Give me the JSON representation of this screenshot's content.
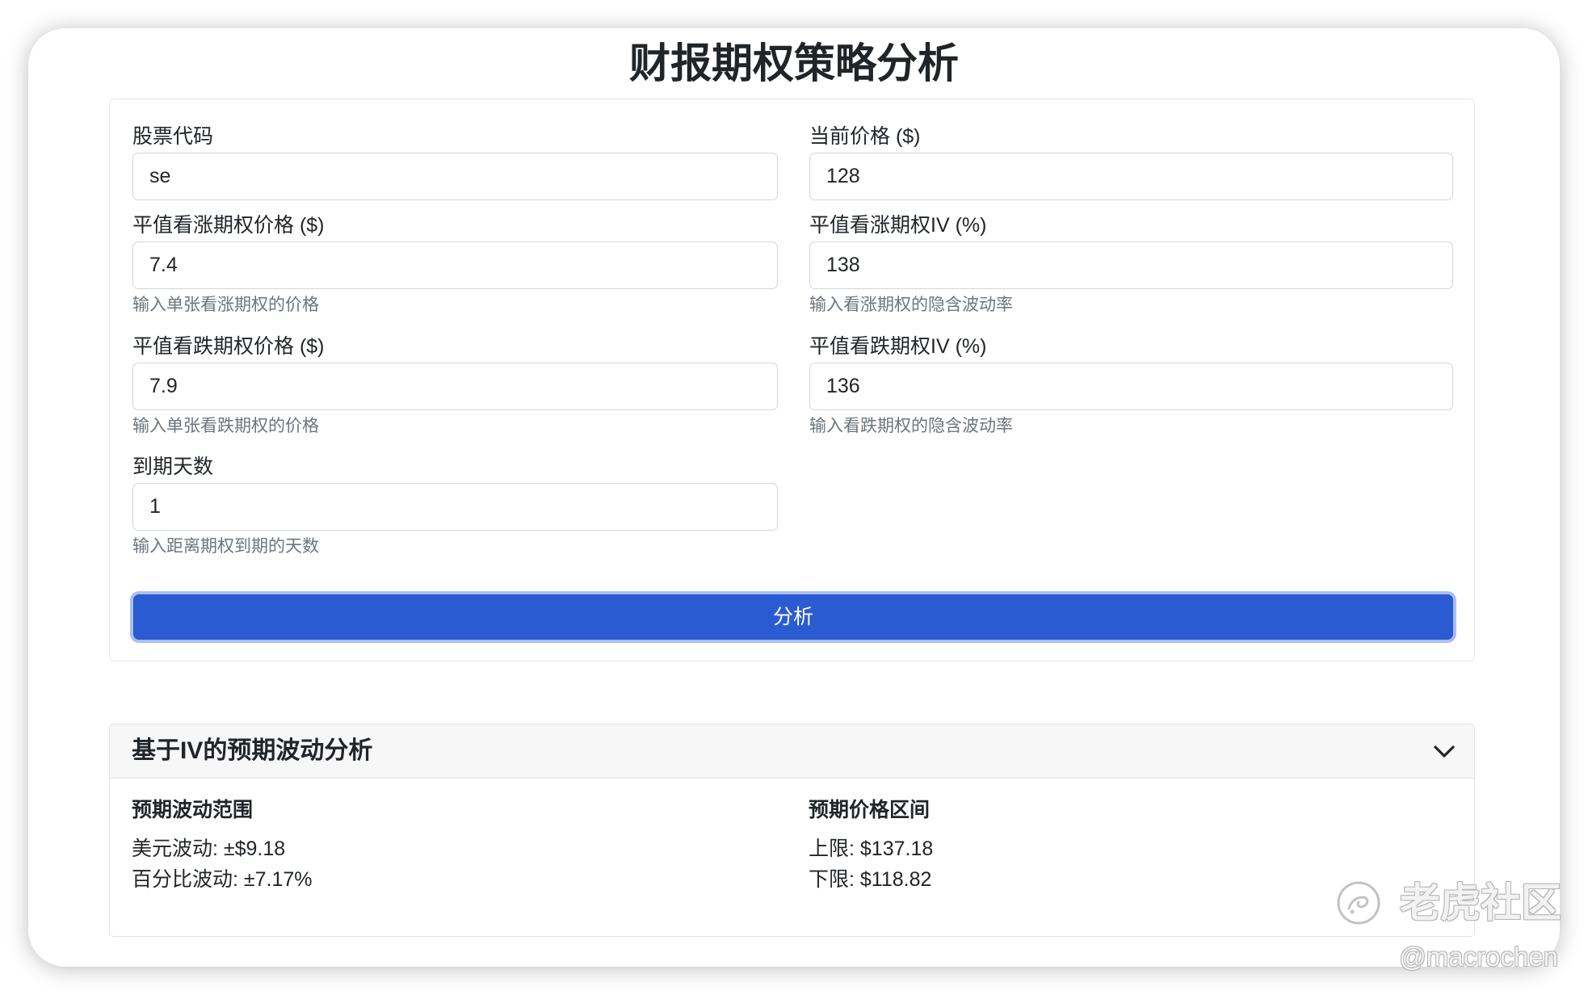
{
  "app": {
    "title": "财报期权策略分析"
  },
  "form": {
    "ticker": {
      "label": "股票代码",
      "value": "se"
    },
    "current_price": {
      "label": "当前价格 ($)",
      "value": "128"
    },
    "call_price": {
      "label": "平值看涨期权价格 ($)",
      "value": "7.4",
      "help": "输入单张看涨期权的价格"
    },
    "call_iv": {
      "label": "平值看涨期权IV (%)",
      "value": "138",
      "help": "输入看涨期权的隐含波动率"
    },
    "put_price": {
      "label": "平值看跌期权价格 ($)",
      "value": "7.9",
      "help": "输入单张看跌期权的价格"
    },
    "put_iv": {
      "label": "平值看跌期权IV (%)",
      "value": "136",
      "help": "输入看跌期权的隐含波动率"
    },
    "days_to_expiry": {
      "label": "到期天数",
      "value": "1",
      "help": "输入距离期权到期的天数"
    },
    "submit_label": "分析"
  },
  "results": {
    "title": "基于IV的预期波动分析",
    "expanded": true,
    "expected_move": {
      "heading": "预期波动范围",
      "dollar_move": "美元波动: ±$9.18",
      "percent_move": "百分比波动: ±7.17%"
    },
    "price_range": {
      "heading": "预期价格区间",
      "upper": "上限: $137.18",
      "lower": "下限: $118.82"
    }
  },
  "watermark": {
    "brand": "老虎社区",
    "handle": "@macrochen"
  },
  "icons": {
    "accordion_toggle": "chevron-down-icon",
    "watermark_logo": "tiger-logo-icon"
  },
  "colors": {
    "primary": "#2b5bd3",
    "focus_ring": "#9db4ee",
    "text": "#212529",
    "muted": "#6c757d",
    "border": "#dee2e6",
    "header_bg": "#f7f7f7"
  }
}
